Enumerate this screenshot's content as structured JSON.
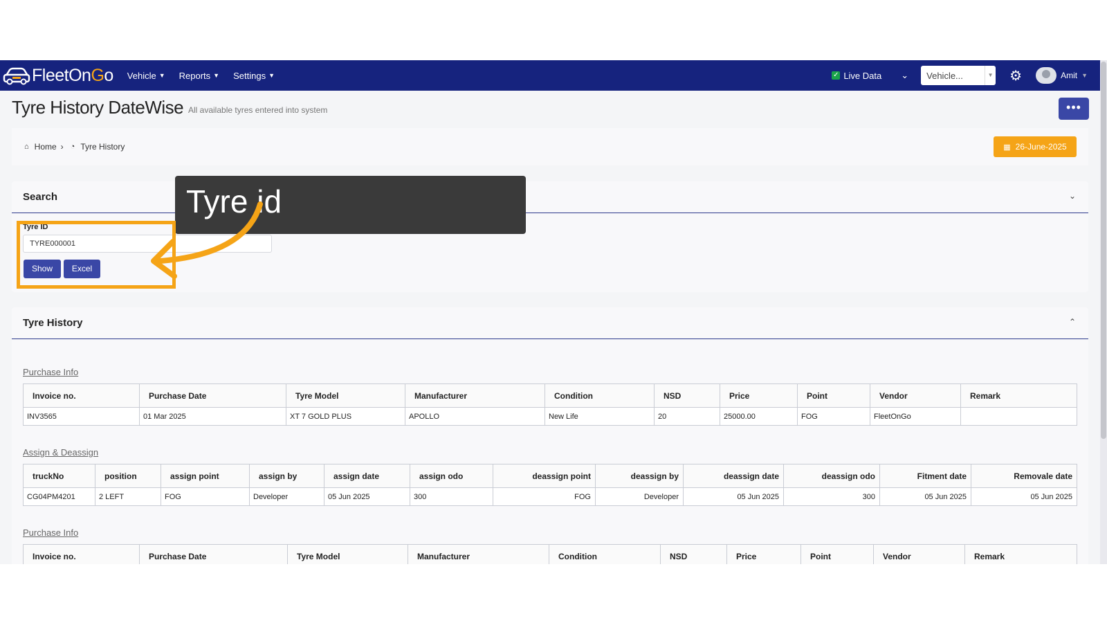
{
  "brand": {
    "name_a": "FleetOn",
    "name_o": "G",
    "name_b": "o"
  },
  "nav": {
    "items": [
      {
        "label": "Vehicle"
      },
      {
        "label": "Reports"
      },
      {
        "label": "Settings"
      }
    ],
    "live_data_label": "Live Data",
    "vehicle_select_value": "Vehicle...",
    "user_name": "Amit"
  },
  "page": {
    "title": "Tyre History DateWise",
    "subtitle": "All available tyres entered into system",
    "more_label": "•••"
  },
  "breadcrumb": {
    "home": "Home",
    "current": "Tyre History",
    "date": "26-June-2025"
  },
  "search": {
    "title": "Search",
    "field_label": "Tyre ID",
    "field_value": "TYRE000001",
    "show_label": "Show",
    "excel_label": "Excel"
  },
  "history": {
    "title": "Tyre History",
    "purchase_section": "Purchase Info",
    "purchase_headers": [
      "Invoice no.",
      "Purchase Date",
      "Tyre Model",
      "Manufacturer",
      "Condition",
      "NSD",
      "Price",
      "Point",
      "Vendor",
      "Remark"
    ],
    "purchase_row": [
      "INV3565",
      "01 Mar 2025",
      "XT 7 GOLD PLUS",
      "APOLLO",
      "New Life",
      "20",
      "25000.00",
      "FOG",
      "FleetOnGo",
      ""
    ],
    "assign_section": "Assign & Deassign",
    "assign_headers": [
      "truckNo",
      "position",
      "assign point",
      "assign by",
      "assign date",
      "assign odo",
      "deassign point",
      "deassign by",
      "deassign date",
      "deassign odo",
      "Fitment date",
      "Removale date"
    ],
    "assign_row": [
      "CG04PM4201",
      "2 LEFT",
      "FOG",
      "Developer",
      "05 Jun 2025",
      "300",
      "FOG",
      "Developer",
      "05 Jun 2025",
      "300",
      "05 Jun 2025",
      "05 Jun 2025"
    ],
    "purchase_section_2": "Purchase Info",
    "purchase_headers_2": [
      "Invoice no.",
      "Purchase Date",
      "Tyre Model",
      "Manufacturer",
      "Condition",
      "NSD",
      "Price",
      "Point",
      "Vendor",
      "Remark"
    ]
  },
  "tooltip": {
    "text": "Tyre id"
  },
  "colors": {
    "nav": "#16237e",
    "accent": "#f5a417",
    "button": "#3a47a6"
  }
}
